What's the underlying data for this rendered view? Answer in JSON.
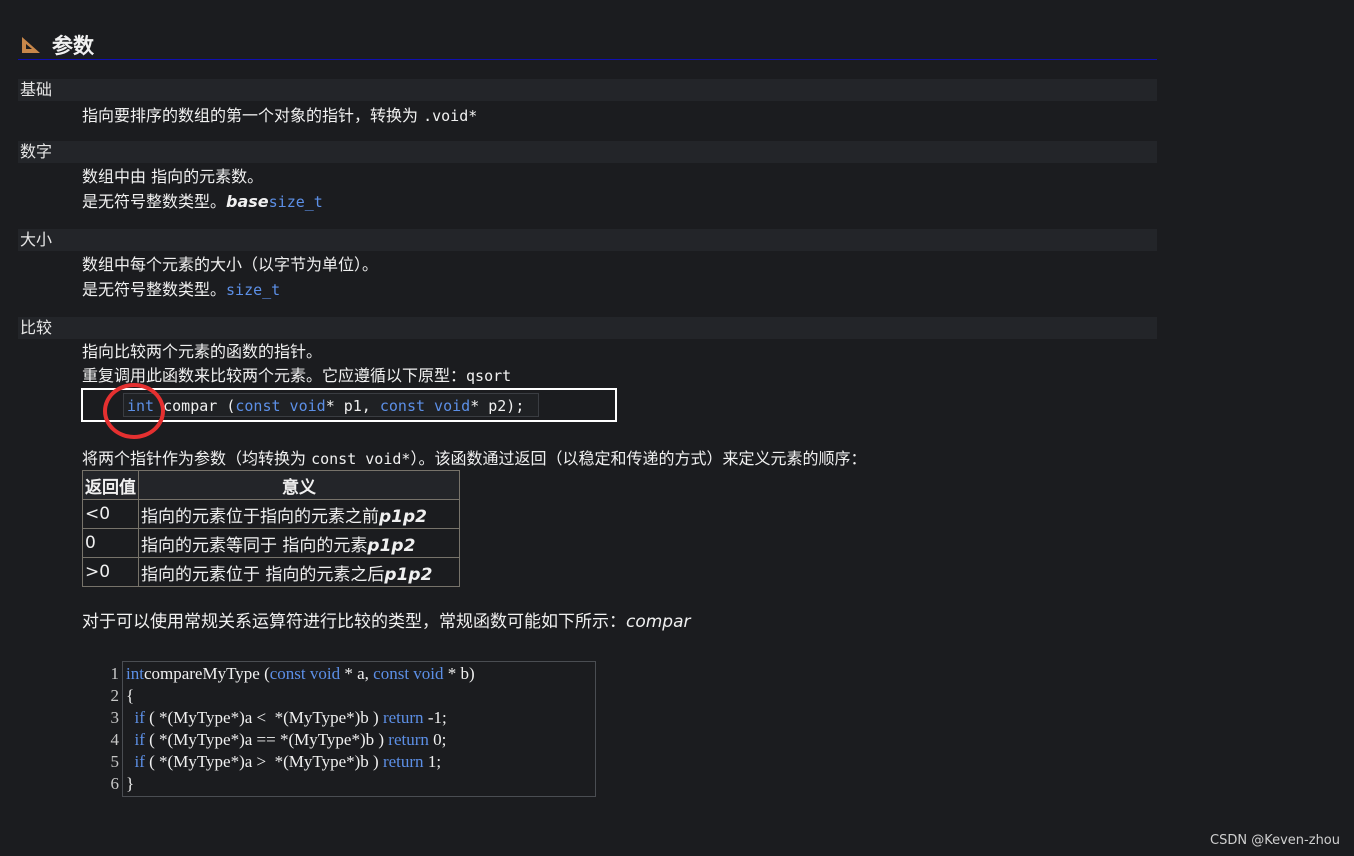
{
  "section": {
    "title": "参数"
  },
  "params": [
    {
      "name": "基础",
      "lines": [
        [
          "指向要排序的数组的第一个对象的指针，转换为 ",
          ".void*"
        ]
      ]
    },
    {
      "name": "数字",
      "lines": [
        "数组中由 指向的元素数。",
        [
          "是无符号整数类型。",
          "base",
          "size_t"
        ]
      ]
    },
    {
      "name": "大小",
      "lines": [
        "数组中每个元素的大小（以字节为单位）。",
        [
          "是无符号整数类型。",
          "size_t"
        ]
      ]
    },
    {
      "name": "比较",
      "lines": [
        "指向比较两个元素的函数的指针。",
        [
          "重复调用此函数来比较两个元素。它应遵循以下原型：",
          "qsort"
        ]
      ]
    }
  ],
  "prototype": {
    "kw1": "int",
    "name": " compar (",
    "kw2": "const void",
    "p1": "* p1, ",
    "kw3": "const void",
    "p2": "* p2);"
  },
  "explain": {
    "text": "将两个指针作为参数（均转换为 ",
    "code": "const void*",
    "rest": "）。该函数通过返回（以稳定和传递的方式）来定义元素的顺序："
  },
  "table": {
    "headers": [
      "返回值",
      "意义"
    ],
    "rows": [
      {
        "value": "<0",
        "text": "指向的元素位于指向的元素之前",
        "it": "p1p2"
      },
      {
        "value": "0",
        "text": "指向的元素等同于 指向的元素",
        "it": "p1p2"
      },
      {
        "value": ">0",
        "text": "指向的元素位于 指向的元素之后",
        "it": "p1p2"
      }
    ]
  },
  "note": {
    "text": "对于可以使用常规关系运算符进行比较的类型，常规函数可能如下所示：",
    "it": "compar"
  },
  "code_lines": [
    {
      "n": "1",
      "parts": [
        [
          "kw",
          "int"
        ],
        [
          "",
          "compareMyType ("
        ],
        [
          "kw",
          "const void"
        ],
        [
          "",
          " * a, "
        ],
        [
          "kw",
          "const void"
        ],
        [
          "",
          " * b)"
        ]
      ]
    },
    {
      "n": "2",
      "parts": [
        [
          "",
          "{"
        ]
      ]
    },
    {
      "n": "3",
      "parts": [
        [
          "",
          "  "
        ],
        [
          "kw",
          "if"
        ],
        [
          "",
          " ( *(MyType*)a <  *(MyType*)b ) "
        ],
        [
          "kw",
          "return"
        ],
        [
          "",
          " -1;"
        ]
      ]
    },
    {
      "n": "4",
      "parts": [
        [
          "",
          "  "
        ],
        [
          "kw",
          "if"
        ],
        [
          "",
          " ( *(MyType*)a == *(MyType*)b ) "
        ],
        [
          "kw",
          "return"
        ],
        [
          "",
          " 0;"
        ]
      ]
    },
    {
      "n": "5",
      "parts": [
        [
          "",
          "  "
        ],
        [
          "kw",
          "if"
        ],
        [
          "",
          " ( *(MyType*)a >  *(MyType*)b ) "
        ],
        [
          "kw",
          "return"
        ],
        [
          "",
          " 1;"
        ]
      ]
    },
    {
      "n": "6",
      "parts": [
        [
          "",
          "}"
        ]
      ]
    }
  ],
  "watermark": "CSDN @Keven-zhou",
  "colors": {
    "keyword": "#5c8fe6",
    "highlight": "#e53030"
  }
}
